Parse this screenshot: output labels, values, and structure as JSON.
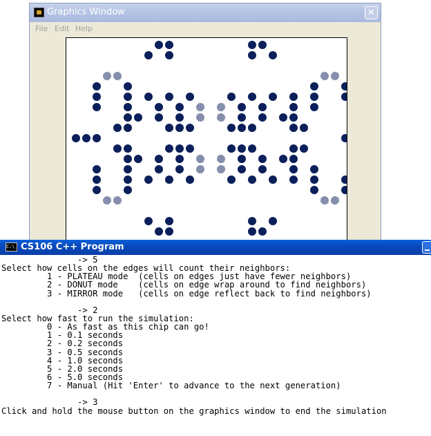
{
  "graphics_window": {
    "title": "Graphics Window",
    "close_glyph": "✕",
    "menu": [
      "File",
      "Edit",
      "Help"
    ]
  },
  "cell_colors": {
    "dark": "#0b1f5a",
    "dither": "#7f8aa8"
  },
  "console_window": {
    "title": "CS106 C++ Program",
    "icon_label": "C:\\",
    "lines": [
      "               -> 5",
      "Select how cells on the edges will count their neighbors:",
      "         1 - PLATEAU mode  (cells on edges just have fewer neighbors)",
      "         2 - DONUT mode    (cells on edge wrap around to find neighbors)",
      "         3 - MIRROR mode   (cells on edge reflect back to find neighbors)",
      "",
      "               -> 2",
      "Select how fast to run the simulation:",
      "         0 - As fast as this chip can go!",
      "         1 - 0.1 seconds",
      "         2 - 0.2 seconds",
      "         3 - 0.5 seconds",
      "         4 - 1.0 seconds",
      "         5 - 2.0 seconds",
      "         6 - 5.0 seconds",
      "         7 - Manual (Hit 'Enter' to advance to the next generation)",
      "",
      "               -> 3",
      "Click and hold the mouse button on the graphics window to end the simulation"
    ]
  }
}
